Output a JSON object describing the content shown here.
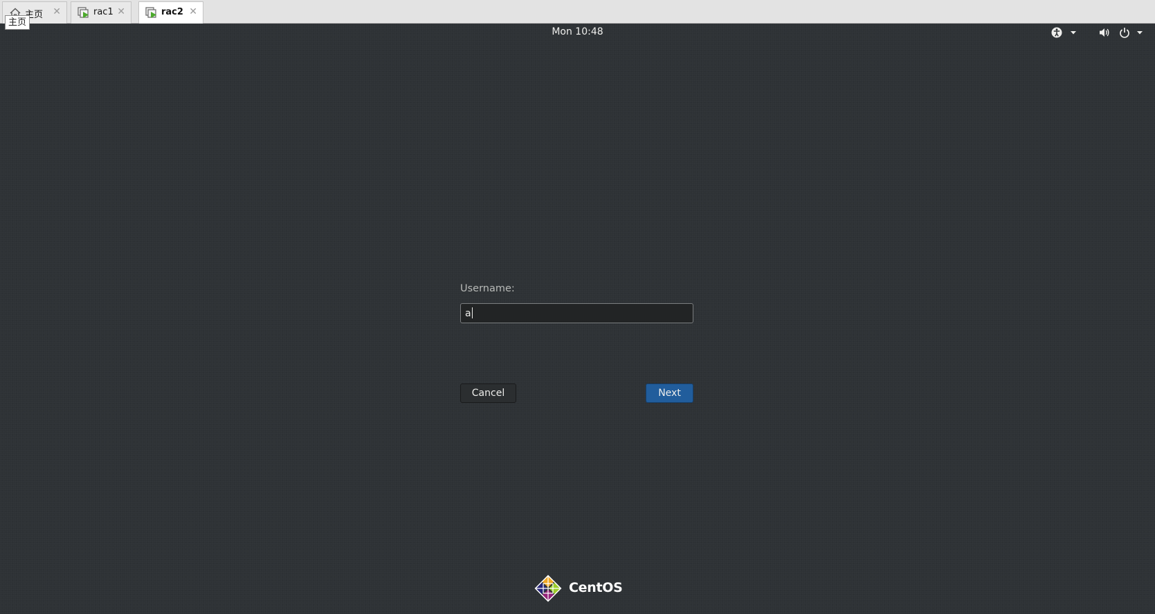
{
  "tooltip": "主页",
  "tabs": [
    {
      "label": "主页",
      "icon": "home-icon",
      "active": false
    },
    {
      "label": "rac1",
      "icon": "vm-icon",
      "active": false
    },
    {
      "label": "rac2",
      "icon": "vm-icon",
      "active": true
    }
  ],
  "tab_close_glyph": "✕",
  "topbar": {
    "clock": "Mon 10:48",
    "icons": [
      "accessibility-icon",
      "volume-icon",
      "power-icon"
    ]
  },
  "login": {
    "username_label": "Username:",
    "username_value": "a",
    "cancel_label": "Cancel",
    "next_label": "Next"
  },
  "logo": {
    "text": "CentOS"
  },
  "colors": {
    "background": "#2e3235",
    "accent_button": "#215d9c"
  }
}
